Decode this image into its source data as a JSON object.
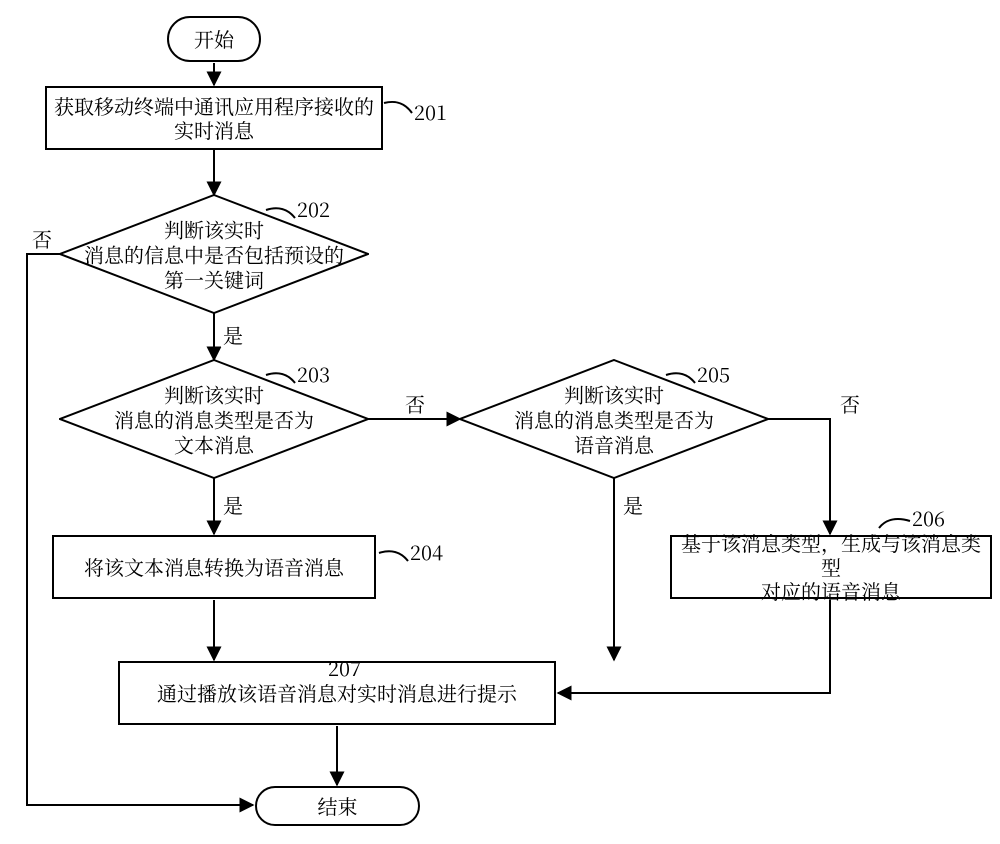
{
  "nodes": {
    "start": "开始",
    "step201": "获取移动终端中通讯应用程序接收的\n实时消息",
    "step202": "判断该实时\n消息的信息中是否包括预设的\n第一关键词",
    "step203": "判断该实时\n消息的消息类型是否为\n文本消息",
    "step204": "将该文本消息转换为语音消息",
    "step205": "判断该实时\n消息的消息类型是否为\n语音消息",
    "step206": "基于该消息类型，生成与该消息类型\n对应的语音消息",
    "step207": "通过播放该语音消息对实时消息进行提示",
    "end": "结束"
  },
  "branches": {
    "yes": "是",
    "no": "否"
  },
  "numbers": {
    "n201": "201",
    "n202": "202",
    "n203": "203",
    "n204": "204",
    "n205": "205",
    "n206": "206",
    "n207": "207"
  }
}
